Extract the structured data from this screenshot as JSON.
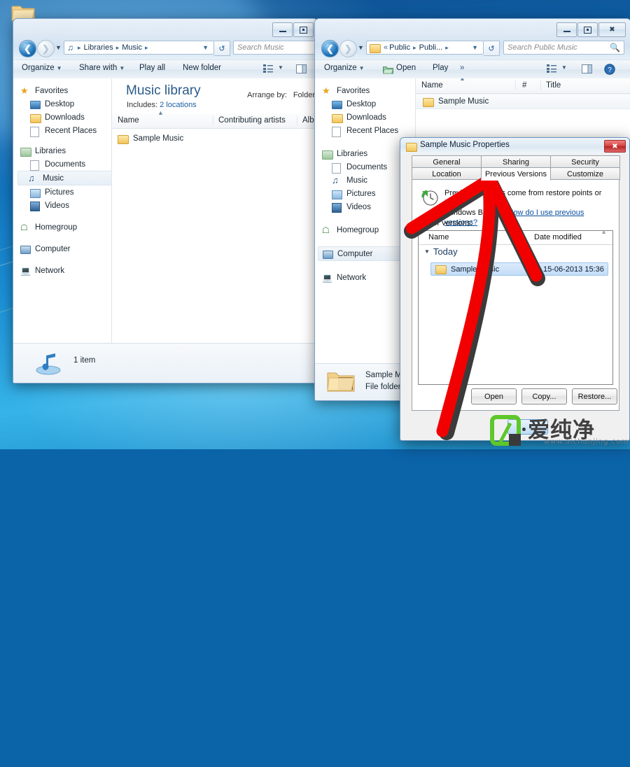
{
  "desktop": {
    "folder_icon": "folder-icon"
  },
  "window_music": {
    "title": "",
    "controls": {
      "minimize": "minimize-icon",
      "maximize": "maximize-icon",
      "close": "close-icon"
    },
    "nav": {
      "back": "back-arrow-icon",
      "forward": "forward-arrow-icon",
      "recent": "recent-pages-icon"
    },
    "address": {
      "icon": "music-note-icon",
      "crumbs": [
        "Libraries",
        "Music"
      ],
      "dropdown": "chevron-down-icon"
    },
    "refresh": "refresh-icon",
    "search": {
      "placeholder": "Search Music",
      "icon": "search-icon"
    },
    "toolbar": {
      "organize": "Organize",
      "share_with": "Share with",
      "play_all": "Play all",
      "new_folder": "New folder",
      "views": "views-icon",
      "preview_pane": "preview-pane-icon"
    },
    "sidebar": [
      {
        "label": "Favorites",
        "icon": "star-icon",
        "group": true
      },
      {
        "label": "Desktop",
        "icon": "desktop-icon"
      },
      {
        "label": "Downloads",
        "icon": "downloads-icon"
      },
      {
        "label": "Recent Places",
        "icon": "recent-places-icon"
      },
      {
        "label": "Libraries",
        "icon": "libraries-icon",
        "group": true
      },
      {
        "label": "Documents",
        "icon": "documents-icon"
      },
      {
        "label": "Music",
        "icon": "music-icon",
        "selected": true
      },
      {
        "label": "Pictures",
        "icon": "pictures-icon"
      },
      {
        "label": "Videos",
        "icon": "videos-icon"
      },
      {
        "label": "Homegroup",
        "icon": "homegroup-icon",
        "group": true
      },
      {
        "label": "Computer",
        "icon": "computer-icon",
        "group": true
      },
      {
        "label": "Network",
        "icon": "network-icon",
        "group": true
      }
    ],
    "library": {
      "heading": "Music library",
      "includes_label": "Includes:",
      "includes_value": "2 locations",
      "arrange_label": "Arrange by:",
      "arrange_value": "Folder"
    },
    "columns": [
      "Name",
      "Contributing artists",
      "Album"
    ],
    "rows": [
      {
        "name": "Sample Music",
        "icon": "folder-icon"
      }
    ],
    "status": {
      "text": "1 item",
      "icon": "music-library-icon"
    }
  },
  "window_public": {
    "controls": {
      "minimize": "minimize-icon",
      "maximize": "maximize-icon",
      "close": "close-icon"
    },
    "nav": {
      "back": "back-arrow-icon",
      "forward": "forward-arrow-icon",
      "recent": "recent-pages-icon"
    },
    "address": {
      "icon": "folder-icon",
      "overflow": "«",
      "crumbs": [
        "Public",
        "Publi..."
      ],
      "dropdown": "chevron-down-icon"
    },
    "refresh": "refresh-icon",
    "search": {
      "placeholder": "Search Public Music",
      "icon": "search-icon"
    },
    "toolbar": {
      "organize": "Organize",
      "open": "Open",
      "play": "Play",
      "more": "»",
      "views": "views-icon",
      "preview_pane": "preview-pane-icon",
      "help": "help-icon"
    },
    "sidebar": [
      {
        "label": "Favorites",
        "icon": "star-icon",
        "group": true
      },
      {
        "label": "Desktop",
        "icon": "desktop-icon"
      },
      {
        "label": "Downloads",
        "icon": "downloads-icon"
      },
      {
        "label": "Recent Places",
        "icon": "recent-places-icon"
      },
      {
        "label": "Libraries",
        "icon": "libraries-icon",
        "group": true
      },
      {
        "label": "Documents",
        "icon": "documents-icon"
      },
      {
        "label": "Music",
        "icon": "music-icon"
      },
      {
        "label": "Pictures",
        "icon": "pictures-icon"
      },
      {
        "label": "Videos",
        "icon": "videos-icon"
      },
      {
        "label": "Homegroup",
        "icon": "homegroup-icon",
        "group": true
      },
      {
        "label": "Computer",
        "icon": "computer-icon",
        "group": true,
        "selected": true
      },
      {
        "label": "Network",
        "icon": "network-icon",
        "group": true
      }
    ],
    "columns": [
      "Name",
      "#",
      "Title"
    ],
    "rows": [
      {
        "name": "Sample Music",
        "icon": "folder-icon"
      }
    ],
    "details": {
      "name": "Sample M",
      "type": "File folder",
      "icon": "open-folder-icon"
    }
  },
  "dialog": {
    "title": "Sample Music Properties",
    "title_icon": "folder-icon",
    "close": "close-icon",
    "tabs_row1": [
      "General",
      "Sharing",
      "Security"
    ],
    "tabs_row2": [
      "Location",
      "Previous Versions",
      "Customize"
    ],
    "active_tab": "Previous Versions",
    "description_1": "Previous versions come from restore points or from",
    "description_2": "Windows Backup.",
    "help_link": "How do I use previous versions?",
    "clock_icon": "restore-clock-icon",
    "folder_versions_label": "Folder versions:",
    "list_columns": [
      "Name",
      "Date modified"
    ],
    "group_label": "Today",
    "group_toggle": "collapse-triangle-icon",
    "items": [
      {
        "name": "Sample Music",
        "date": "15-06-2013 15:36",
        "icon": "folder-icon",
        "selected": true
      }
    ],
    "buttons": [
      "Open",
      "Copy...",
      "Restore..."
    ]
  },
  "annotation": {
    "shape": "red-arrow",
    "color": "#f20000",
    "outline": "#3b3b3b",
    "points_to": "Previous Versions"
  },
  "watermark": {
    "brand": "爱纯净",
    "url": "www.aichunjing.com",
    "logo_color": "#5fc72a"
  }
}
